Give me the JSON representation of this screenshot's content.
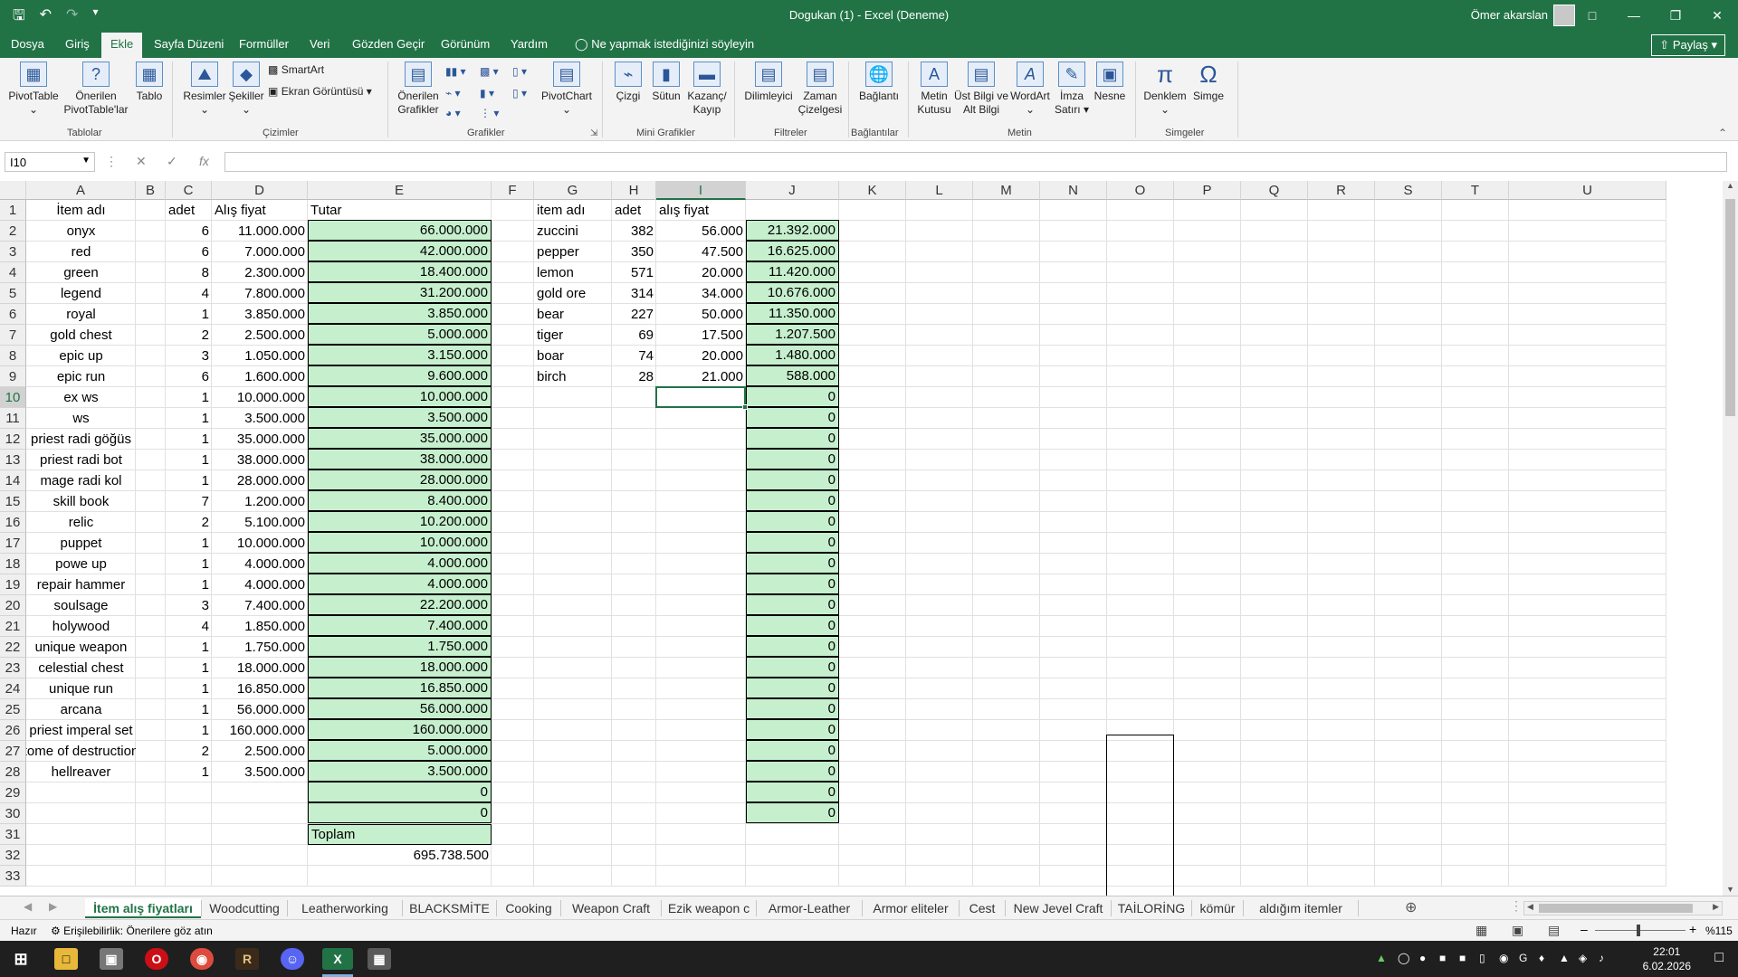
{
  "window": {
    "title": "Dogukan (1)  -  Excel (Deneme)",
    "user": "Ömer akarslan",
    "controls": [
      "□",
      "—",
      "❐",
      "✕"
    ]
  },
  "menu": {
    "tabs": [
      "Dosya",
      "Giriş",
      "Ekle",
      "Sayfa Düzeni",
      "Formüller",
      "Veri",
      "Gözden Geçir",
      "Görünüm",
      "Yardım"
    ],
    "active": "Ekle",
    "tell_me": "Ne yapmak istediğinizi söyleyin",
    "share": "Paylaş"
  },
  "ribbon": {
    "buttons": {
      "pivottable": "PivotTable",
      "recommended_pivot": "Önerilen PivotTable'lar",
      "table": "Tablo",
      "pictures": "Resimler",
      "shapes": "Şekiller",
      "smartart": "SmartArt",
      "screenshot": "Ekran Görüntüsü",
      "recommended_charts": "Önerilen Grafikler",
      "pivotchart": "PivotChart",
      "line": "Çizgi",
      "column": "Sütun",
      "winloss": "Kazanç/ Kayıp",
      "slicer": "Dilimleyici",
      "timeline": "Zaman Çizelgesi",
      "link": "Bağlantı",
      "textbox": "Metin Kutusu",
      "header_footer": "Üst Bilgi ve Alt Bilgi",
      "wordart": "WordArt",
      "signature": "İmza Satırı",
      "object": "Nesne",
      "equation": "Denklem",
      "symbol": "Simge"
    },
    "groups": {
      "tables": "Tablolar",
      "illustrations": "Çizimler",
      "charts": "Grafikler",
      "sparklines": "Mini Grafikler",
      "filters": "Filtreler",
      "links": "Bağlantılar",
      "text": "Metin",
      "symbols": "Simgeler"
    }
  },
  "formula_bar": {
    "name_box": "I10",
    "formula": ""
  },
  "columns": [
    "A",
    "B",
    "C",
    "D",
    "E",
    "F",
    "G",
    "H",
    "I",
    "J",
    "K",
    "L",
    "M",
    "N",
    "O",
    "P",
    "Q",
    "R",
    "S",
    "T",
    "U"
  ],
  "rows": [
    "1",
    "2",
    "3",
    "4",
    "5",
    "6",
    "7",
    "8",
    "9",
    "10",
    "11",
    "12",
    "13",
    "14",
    "15",
    "16",
    "17",
    "18",
    "19",
    "20",
    "21",
    "22",
    "23",
    "24",
    "25",
    "26",
    "27",
    "28",
    "29",
    "30",
    "31",
    "32",
    "33"
  ],
  "table1": {
    "headers": [
      "İtem adı",
      "adet",
      "Alış fiyat",
      "Tutar"
    ],
    "rows": [
      [
        "onyx",
        "6",
        "11.000.000",
        "66.000.000"
      ],
      [
        "red",
        "6",
        "7.000.000",
        "42.000.000"
      ],
      [
        "green",
        "8",
        "2.300.000",
        "18.400.000"
      ],
      [
        "legend",
        "4",
        "7.800.000",
        "31.200.000"
      ],
      [
        "royal",
        "1",
        "3.850.000",
        "3.850.000"
      ],
      [
        "gold chest",
        "2",
        "2.500.000",
        "5.000.000"
      ],
      [
        "epic up",
        "3",
        "1.050.000",
        "3.150.000"
      ],
      [
        "epic run",
        "6",
        "1.600.000",
        "9.600.000"
      ],
      [
        "ex ws",
        "1",
        "10.000.000",
        "10.000.000"
      ],
      [
        "ws",
        "1",
        "3.500.000",
        "3.500.000"
      ],
      [
        "priest radi göğüs",
        "1",
        "35.000.000",
        "35.000.000"
      ],
      [
        "priest radi bot",
        "1",
        "38.000.000",
        "38.000.000"
      ],
      [
        "mage radi kol",
        "1",
        "28.000.000",
        "28.000.000"
      ],
      [
        "skill book",
        "7",
        "1.200.000",
        "8.400.000"
      ],
      [
        "relic",
        "2",
        "5.100.000",
        "10.200.000"
      ],
      [
        "puppet",
        "1",
        "10.000.000",
        "10.000.000"
      ],
      [
        "powe up",
        "1",
        "4.000.000",
        "4.000.000"
      ],
      [
        "repair hammer",
        "1",
        "4.000.000",
        "4.000.000"
      ],
      [
        "soulsage",
        "3",
        "7.400.000",
        "22.200.000"
      ],
      [
        "holywood",
        "4",
        "1.850.000",
        "7.400.000"
      ],
      [
        "unique weapon",
        "1",
        "1.750.000",
        "1.750.000"
      ],
      [
        "celestial chest",
        "1",
        "18.000.000",
        "18.000.000"
      ],
      [
        "unique run",
        "1",
        "16.850.000",
        "16.850.000"
      ],
      [
        "arcana",
        "1",
        "56.000.000",
        "56.000.000"
      ],
      [
        "priest imperal set",
        "1",
        "160.000.000",
        "160.000.000"
      ],
      [
        "tome of destruction",
        "2",
        "2.500.000",
        "5.000.000"
      ],
      [
        "hellreaver",
        "1",
        "3.500.000",
        "3.500.000"
      ],
      [
        "",
        "",
        "",
        "0"
      ],
      [
        "",
        "",
        "",
        "0"
      ]
    ],
    "total_label": "Toplam",
    "total_value": "695.738.500"
  },
  "table2": {
    "headers": [
      "item adı",
      "adet",
      "alış fiyat"
    ],
    "rows": [
      [
        "zuccini",
        "382",
        "56.000",
        "21.392.000"
      ],
      [
        "pepper",
        "350",
        "47.500",
        "16.625.000"
      ],
      [
        "lemon",
        "571",
        "20.000",
        "11.420.000"
      ],
      [
        "gold ore",
        "314",
        "34.000",
        "10.676.000"
      ],
      [
        "bear",
        "227",
        "50.000",
        "11.350.000"
      ],
      [
        "tiger",
        "69",
        "17.500",
        "1.207.500"
      ],
      [
        "boar",
        "74",
        "20.000",
        "1.480.000"
      ],
      [
        "birch",
        "28",
        "21.000",
        "588.000"
      ],
      [
        "",
        "",
        "",
        "0"
      ],
      [
        "",
        "",
        "",
        "0"
      ],
      [
        "",
        "",
        "",
        "0"
      ],
      [
        "",
        "",
        "",
        "0"
      ],
      [
        "",
        "",
        "",
        "0"
      ],
      [
        "",
        "",
        "",
        "0"
      ],
      [
        "",
        "",
        "",
        "0"
      ],
      [
        "",
        "",
        "",
        "0"
      ],
      [
        "",
        "",
        "",
        "0"
      ],
      [
        "",
        "",
        "",
        "0"
      ],
      [
        "",
        "",
        "",
        "0"
      ],
      [
        "",
        "",
        "",
        "0"
      ],
      [
        "",
        "",
        "",
        "0"
      ],
      [
        "",
        "",
        "",
        "0"
      ],
      [
        "",
        "",
        "",
        "0"
      ],
      [
        "",
        "",
        "",
        "0"
      ],
      [
        "",
        "",
        "",
        "0"
      ],
      [
        "",
        "",
        "",
        "0"
      ],
      [
        "",
        "",
        "",
        "0"
      ],
      [
        "",
        "",
        "",
        "0"
      ],
      [
        "",
        "",
        "",
        "0"
      ]
    ]
  },
  "sheet_tabs": [
    "İtem alış fiyatları",
    "Woodcutting",
    "Leatherworking",
    "BLACKSMİTE",
    "Cooking",
    "Weapon Craft",
    "Ezik weapon c",
    "Armor-Leather",
    "Armor eliteler",
    "Cest",
    "New Jevel Craft",
    "TAİLORİNG",
    "kömür",
    "aldığım itemler"
  ],
  "active_sheet": "İtem alış fiyatları",
  "status": {
    "ready": "Hazır",
    "accessibility": "Erişilebilirlik: Önerilere göz atın",
    "zoom": "%115"
  },
  "taskbar": {
    "time": "22:01",
    "date": "6.02.2026"
  }
}
